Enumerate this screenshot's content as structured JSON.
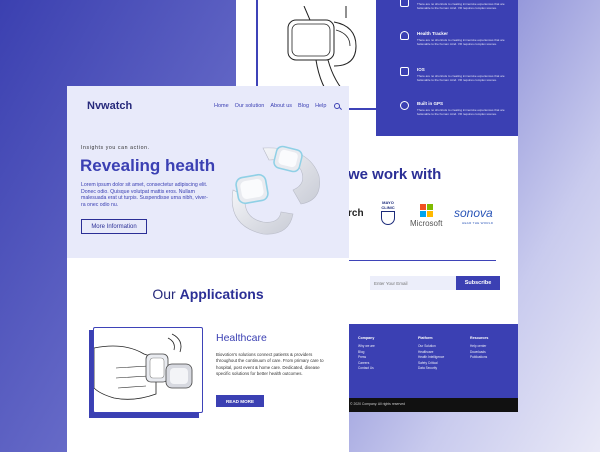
{
  "back": {
    "features": [
      {
        "title": "",
        "desc": "There are no shortcuts to creating immersive experiences that are believable to the human mind. VR requires complex scenes.",
        "icon": "location-icon"
      },
      {
        "title": "Health Tracker",
        "desc": "There are no shortcuts to creating immersive experiences that are believable to the human mind. VR requires complex scenes.",
        "icon": "heart-icon"
      },
      {
        "title": "IOS",
        "desc": "There are no shortcuts to creating immersive experiences that are believable to the human mind. VR requires complex scenes.",
        "icon": "phone-icon"
      },
      {
        "title": "Built in GPS",
        "desc": "There are no shortcuts to creating immersive experiences that are believable to the human mind. VR requires complex scenes.",
        "icon": "pin-icon"
      }
    ],
    "work_title": "we work with",
    "partners": {
      "partial": "rch",
      "mayo": "MAYO CLINIC",
      "microsoft": "Microsoft",
      "sonova": "sonova",
      "sonova_tag": "HEAR THE WORLD"
    },
    "newsletter": {
      "placeholder": "Enter Your Email",
      "button": "Subscribe"
    },
    "footer": {
      "columns": [
        {
          "heading": "Company",
          "links": [
            "Why we are",
            "Blog",
            "Press",
            "Careers",
            "Contact Us"
          ]
        },
        {
          "heading": "Platform",
          "links": [
            "Our Solution",
            "Healthcare",
            "Health Intelligence",
            "Safety Critical",
            "Data Security"
          ]
        },
        {
          "heading": "Resources",
          "links": [
            "Help center",
            "Downloads",
            "Publications"
          ]
        }
      ],
      "copyright": "© 2020 Company. All rights reserved"
    }
  },
  "front": {
    "brand": "Nvwatch",
    "nav": [
      "Home",
      "Our solution",
      "About us",
      "Blog",
      "Help"
    ],
    "tagline": "Insights you can action.",
    "hero_title": "Revealing health",
    "hero_text": "Lorem ipsum dolor sit amet, consectetur adipiscing elit. Donec odio. Quisque volutpat mattis eros. Nullam malesuada erat ut turpis. Suspendisse urna nibh, viverra non semper suscipit, posuere a, pede.",
    "hero_text_short": "Lorem ipsum dolor sit amet, consectetur adipiscing elit. Donec odio. Quisque volutpat mattis eros. Nullam malesuada erat ut turpis. Suspendisse urna nibh, viver- ra onec odio nu.",
    "more_button": "More Information",
    "apps_title_plain": "Our",
    "apps_title_bold": "Applications",
    "app": {
      "name": "Healthcare",
      "desc": "Biovotion's solutions connect patients & providers throughout the continuum of care. From primary care to hospital, post event & home care. Dedicated, disease specific solutions for better health outcomes.",
      "button": "READ MORE"
    }
  },
  "colors": {
    "primary": "#3b40b3",
    "dark": "#272a7c",
    "hero_bg": "#e8eafa"
  }
}
